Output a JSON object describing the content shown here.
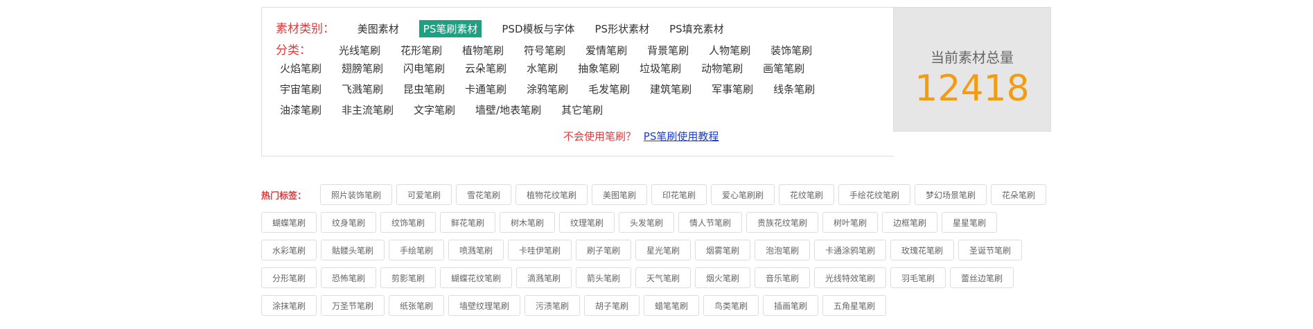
{
  "category": {
    "label": "素材类别：",
    "items": [
      "美图素材",
      "PS笔刷素材",
      "PSD模板与字体",
      "PS形状素材",
      "PS填充素材"
    ],
    "active_index": 1
  },
  "subcategory": {
    "label": "分类：",
    "rows": [
      [
        "光线笔刷",
        "花形笔刷",
        "植物笔刷",
        "符号笔刷",
        "爱情笔刷",
        "背景笔刷",
        "人物笔刷",
        "装饰笔刷"
      ],
      [
        "火焰笔刷",
        "翅膀笔刷",
        "闪电笔刷",
        "云朵笔刷",
        "水笔刷",
        "抽象笔刷",
        "垃圾笔刷",
        "动物笔刷",
        "画笔笔刷"
      ],
      [
        "宇宙笔刷",
        "飞溅笔刷",
        "昆虫笔刷",
        "卡通笔刷",
        "涂鸦笔刷",
        "毛发笔刷",
        "建筑笔刷",
        "军事笔刷",
        "线条笔刷"
      ],
      [
        "油漆笔刷",
        "非主流笔刷",
        "文字笔刷",
        "墙壁/地表笔刷",
        "其它笔刷"
      ]
    ]
  },
  "help": {
    "question": "不会使用笔刷？",
    "link": "PS笔刷使用教程"
  },
  "counter": {
    "label": "当前素材总量",
    "value": "12418"
  },
  "hot_tags": {
    "label": "热门标签：",
    "rows": [
      [
        "照片装饰笔刷",
        "可爱笔刷",
        "雪花笔刷",
        "植物花纹笔刷",
        "美图笔刷",
        "印花笔刷",
        "爱心笔刷刷",
        "花纹笔刷",
        "手绘花纹笔刷",
        "梦幻场景笔刷",
        "花朵笔刷"
      ],
      [
        "蝴蝶笔刷",
        "纹身笔刷",
        "纹饰笔刷",
        "鲜花笔刷",
        "树木笔刷",
        "纹理笔刷",
        "头发笔刷",
        "情人节笔刷",
        "贵族花纹笔刷",
        "树叶笔刷",
        "边框笔刷",
        "星星笔刷"
      ],
      [
        "水彩笔刷",
        "骷髅头笔刷",
        "手绘笔刷",
        "喷溅笔刷",
        "卡哇伊笔刷",
        "刷子笔刷",
        "星光笔刷",
        "烟雾笔刷",
        "泡泡笔刷",
        "卡通涂鸦笔刷",
        "玫瑰花笔刷",
        "圣诞节笔刷"
      ],
      [
        "分形笔刷",
        "恐怖笔刷",
        "剪影笔刷",
        "蝴蝶花纹笔刷",
        "滴溅笔刷",
        "箭头笔刷",
        "天气笔刷",
        "烟火笔刷",
        "音乐笔刷",
        "光线特效笔刷",
        "羽毛笔刷",
        "蕾丝边笔刷"
      ],
      [
        "涂抹笔刷",
        "万圣节笔刷",
        "纸张笔刷",
        "墙壁纹理笔刷",
        "污渍笔刷",
        "胡子笔刷",
        "蜡笔笔刷",
        "鸟类笔刷",
        "插画笔刷",
        "五角星笔刷"
      ]
    ]
  }
}
